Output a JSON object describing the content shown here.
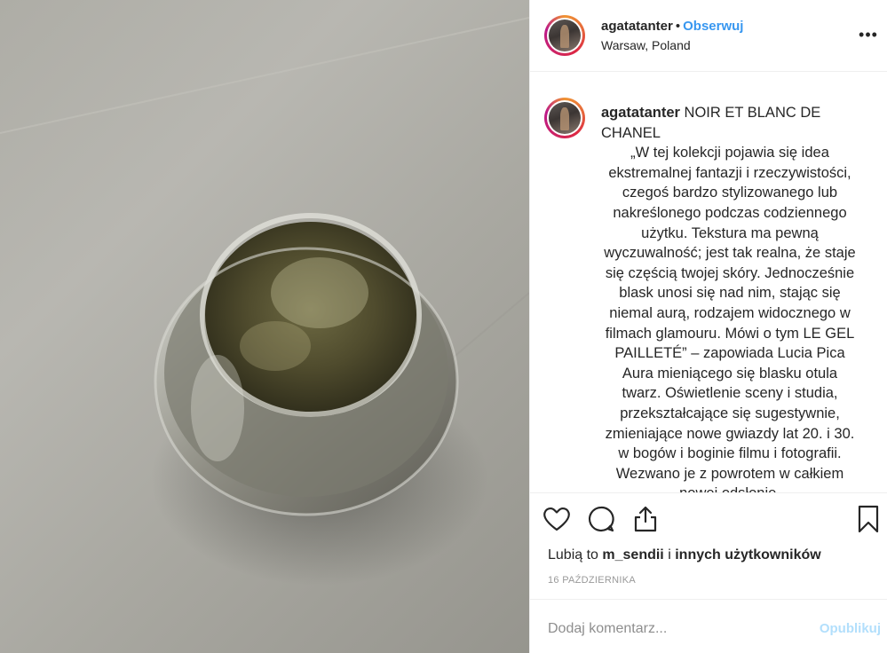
{
  "header": {
    "username": "agatatanter",
    "separator": "•",
    "follow_label": "Obserwuj",
    "location": "Warsaw, Poland",
    "more_label": "•••"
  },
  "caption": {
    "username": "agatatanter",
    "title": "NOIR ET BLANC DE CHANEL",
    "body": "„W tej kolekcji pojawia się idea ekstremalnej fantazji i rzeczywistości, czegoś bardzo stylizowanego lub nakreślonego podczas codziennego użytku. Tekstura ma pewną wyczuwalność; jest tak realna, że staje się częścią twojej skóry. Jednocześnie blask unosi się nad nim, stając się niemal aurą, rodzajem widocznego w filmach glamouru. Mówi o tym LE GEL PAILLETÉ” – zapowiada Lucia Pica Aura mieniącego się blasku otula twarz. Oświetlenie sceny i studia, przekształcające się sugestywnie, zmieniające nowe gwiazdy lat 20. i 30. w bogów i boginie filmu i fotografii. Wezwano je z powrotem w całkiem nowej odsłonie."
  },
  "actions": {
    "icons": [
      "heart-icon",
      "comment-icon",
      "share-icon",
      "bookmark-icon"
    ]
  },
  "likes": {
    "prefix": "Lubią to",
    "user": "m_sendii",
    "conjunction": "i",
    "others": "innych użytkowników"
  },
  "date": "16 PAŹDZIERNIKA",
  "comment": {
    "placeholder": "Dodaj komentarz...",
    "post_label": "Opublikuj"
  },
  "colors": {
    "link_blue": "#3897f0",
    "post_disabled": "#b2dffc",
    "muted": "#999999",
    "border": "#efefef"
  }
}
